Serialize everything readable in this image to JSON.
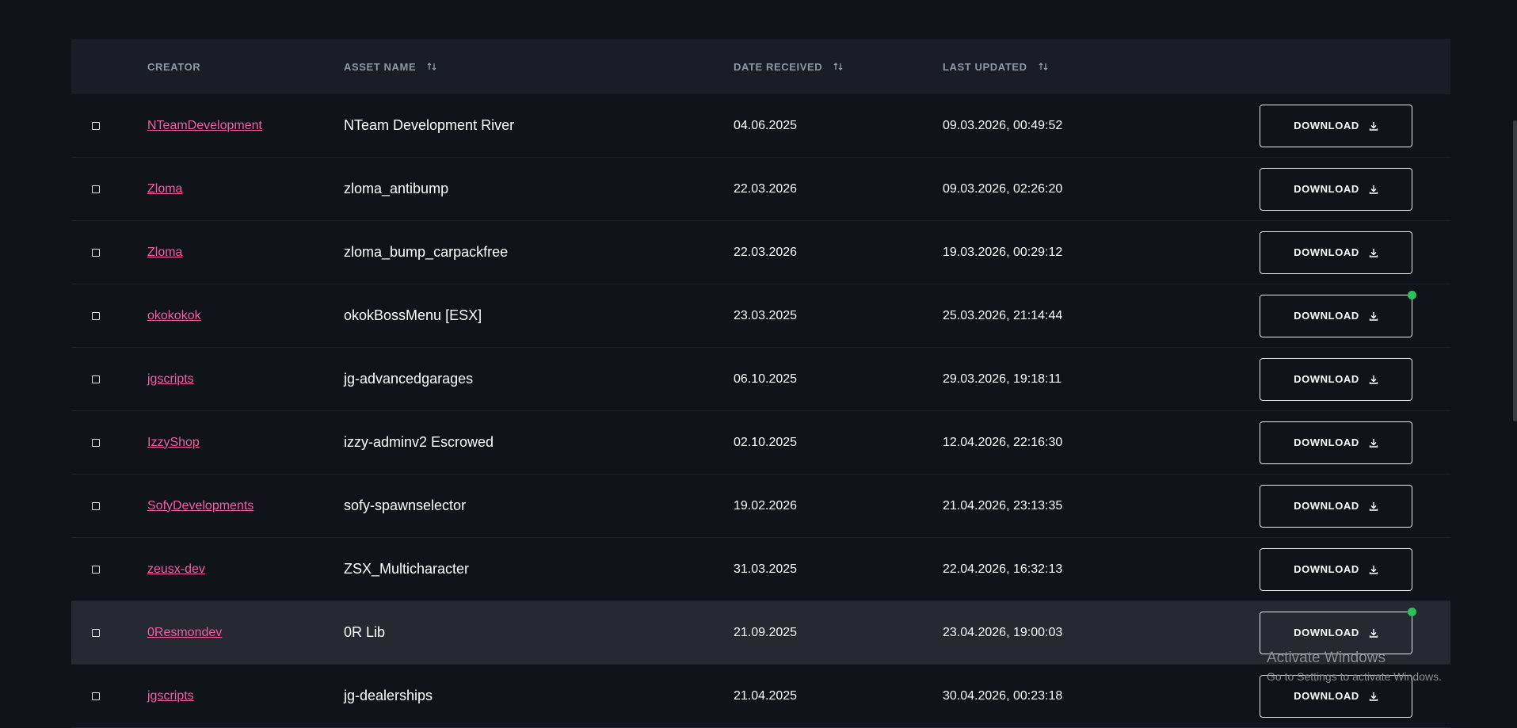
{
  "table": {
    "headers": {
      "creator": "CREATOR",
      "asset_name": "ASSET NAME",
      "date_received": "DATE RECEIVED",
      "last_updated": "LAST UPDATED"
    },
    "download_label": "DOWNLOAD",
    "rows": [
      {
        "creator": "NTeamDevelopment",
        "asset": "NTeam Development River",
        "received": "04.06.2025",
        "updated": "09.03.2026, 00:49:52",
        "new": false,
        "highlight": false
      },
      {
        "creator": "Zloma",
        "asset": "zloma_antibump",
        "received": "22.03.2026",
        "updated": "09.03.2026, 02:26:20",
        "new": false,
        "highlight": false
      },
      {
        "creator": "Zloma",
        "asset": "zloma_bump_carpackfree",
        "received": "22.03.2026",
        "updated": "19.03.2026, 00:29:12",
        "new": false,
        "highlight": false
      },
      {
        "creator": "okokokok",
        "asset": "okokBossMenu [ESX]",
        "received": "23.03.2025",
        "updated": "25.03.2026, 21:14:44",
        "new": true,
        "highlight": false
      },
      {
        "creator": "jgscripts",
        "asset": "jg-advancedgarages",
        "received": "06.10.2025",
        "updated": "29.03.2026, 19:18:11",
        "new": false,
        "highlight": false
      },
      {
        "creator": "IzzyShop",
        "asset": "izzy-adminv2 Escrowed",
        "received": "02.10.2025",
        "updated": "12.04.2026, 22:16:30",
        "new": false,
        "highlight": false
      },
      {
        "creator": "SofyDevelopments",
        "asset": "sofy-spawnselector",
        "received": "19.02.2026",
        "updated": "21.04.2026, 23:13:35",
        "new": false,
        "highlight": false
      },
      {
        "creator": "zeusx-dev",
        "asset": "ZSX_Multicharacter",
        "received": "31.03.2025",
        "updated": "22.04.2026, 16:32:13",
        "new": false,
        "highlight": false
      },
      {
        "creator": "0Resmondev",
        "asset": "0R Lib",
        "received": "21.09.2025",
        "updated": "23.04.2026, 19:00:03",
        "new": true,
        "highlight": true
      },
      {
        "creator": "jgscripts",
        "asset": "jg-dealerships",
        "received": "21.04.2025",
        "updated": "30.04.2026, 00:23:18",
        "new": false,
        "highlight": false
      }
    ]
  },
  "watermark": {
    "title": "Activate Windows",
    "subtitle": "Go to Settings to activate Windows."
  },
  "colors": {
    "creator_link": "#f25ca5",
    "new_dot": "#27c25a",
    "background": "#11131a",
    "header_bg": "#1a1d26"
  },
  "icons": {
    "sort": "sort-arrows-icon",
    "download": "download-icon",
    "checkbox": "checkbox-icon"
  }
}
